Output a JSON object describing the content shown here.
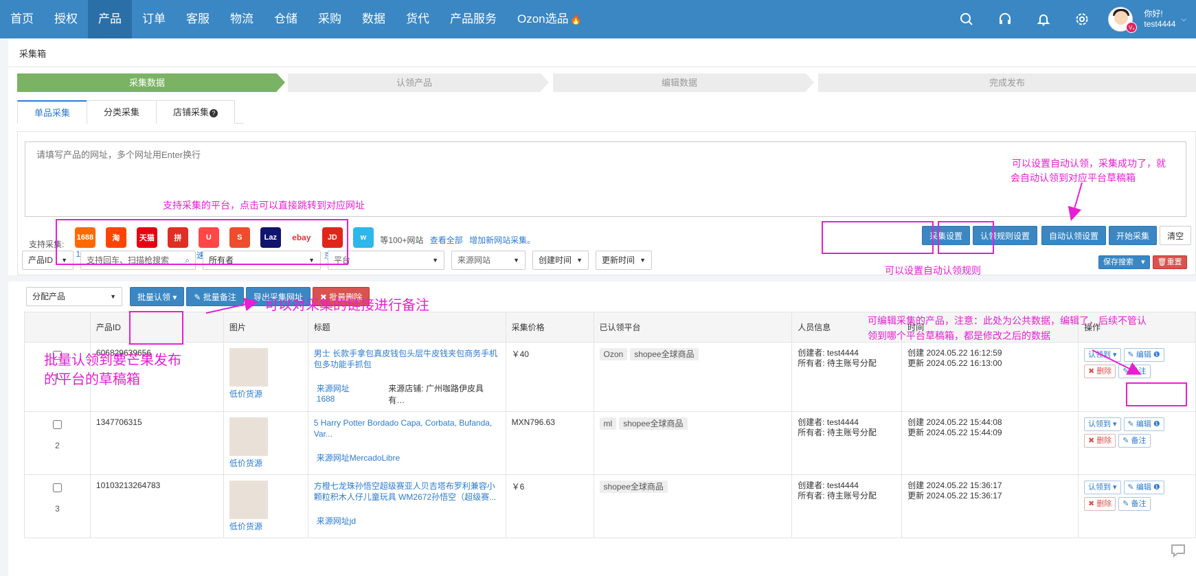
{
  "nav": {
    "items": [
      "首页",
      "授权",
      "产品",
      "订单",
      "客服",
      "物流",
      "仓储",
      "采购",
      "数据",
      "货代",
      "产品服务",
      "Ozon选品"
    ],
    "active_index": 2,
    "user_greeting": "你好!",
    "username": "test4444",
    "vip_badge": "V₄"
  },
  "breadcrumb": "采集箱",
  "steps": [
    "采集数据",
    "认领产品",
    "编辑数据",
    "完成发布"
  ],
  "tabs": [
    "单品采集",
    "分类采集",
    "店铺采集"
  ],
  "url_input": {
    "placeholder": "请填写产品的网址，多个网址用Enter换行"
  },
  "platforms": {
    "label": "支持采集:",
    "items": [
      {
        "name": "1688",
        "logo_text": "1688",
        "color": "#ff6a00"
      },
      {
        "name": "淘宝网",
        "logo_text": "淘",
        "color": "#ff4400"
      },
      {
        "name": "天猫",
        "logo_text": "天猫",
        "color": "#e60012"
      },
      {
        "name": "拼多多",
        "logo_text": "拼",
        "color": "#e02e24"
      },
      {
        "name": "速卖通",
        "logo_text": "U",
        "color": "#ff4747"
      },
      {
        "name": "shopee",
        "logo_text": "S",
        "color": "#ee4d2d"
      },
      {
        "name": "lazada",
        "logo_text": "Laz",
        "color": "#0f146d"
      },
      {
        "name": "ebay",
        "logo_text": "ebay",
        "color": "#ffffff"
      },
      {
        "name": "京东",
        "logo_text": "JD",
        "color": "#e1251b"
      },
      {
        "name": "wish",
        "logo_text": "w",
        "color": "#2fb7ec"
      }
    ],
    "more_text": "等100+网站",
    "view_all": "查看全部",
    "add_site": "增加新网站采集。"
  },
  "actions": {
    "collect_settings": "采集设置",
    "claim_rules": "认领规则设置",
    "auto_claim": "自动认领设置",
    "start": "开始采集",
    "clear": "清空"
  },
  "filters": {
    "product_id": "产品ID",
    "search_placeholder": "支持回车、扫描枪搜索",
    "owner": "所有者",
    "platform": "平台",
    "source_site": "来源网站",
    "created_time": "创建时间",
    "updated_time": "更新时间",
    "save_search": "保存搜索",
    "reset": "重置"
  },
  "toolbar": {
    "assign": "分配产品",
    "batch_claim": "批量认领",
    "batch_note": "批量备注",
    "export_urls": "导出采集网址",
    "batch_delete": "批量删除"
  },
  "table": {
    "headers": [
      "",
      "产品ID",
      "图片",
      "标题",
      "采集价格",
      "已认领平台",
      "人员信息",
      "时间",
      "操作"
    ],
    "rows": [
      {
        "index": "1",
        "id": "606829639656",
        "thumb_link": "低价货源",
        "title": "男士 长款手拿包真皮钱包头层牛皮钱夹包商务手机包多功能手抓包",
        "source": "来源网址1688",
        "store": "来源店铺: 广州咖路伊皮具有…",
        "price": "￥40",
        "platforms": [
          "Ozon",
          "shopee全球商品"
        ],
        "creator": "创建者:  test4444",
        "owner": "所有者:  待主账号分配",
        "created": "创建 2024.05.22 16:12:59",
        "updated": "更新 2024.05.22 16:13:00"
      },
      {
        "index": "2",
        "id": "1347706315",
        "thumb_link": "低价货源",
        "title": "5 Harry Potter Bordado Capa, Corbata, Bufanda, Var...",
        "source": "来源网址MercadoLibre",
        "store": "",
        "price": "MXN796.63",
        "platforms": [
          "ml",
          "shopee全球商品"
        ],
        "creator": "创建者:  test4444",
        "owner": "所有者:  待主账号分配",
        "created": "创建 2024.05.22 15:44:08",
        "updated": "更新 2024.05.22 15:44:09"
      },
      {
        "index": "3",
        "id": "10103213264783",
        "thumb_link": "低价货源",
        "title": "方橙七龙珠孙悟空超级赛亚人贝吉塔布罗利兼容小颗粒积木人仔儿童玩具 WM2672孙悟空（超级赛...",
        "source": "来源网址jd",
        "store": "",
        "price": "￥6",
        "platforms": [
          "shopee全球商品"
        ],
        "creator": "创建者:  test4444",
        "owner": "所有者:  待主账号分配",
        "created": "创建 2024.05.22 15:36:17",
        "updated": "更新 2024.05.22 15:36:17"
      }
    ],
    "op": {
      "claim": "认领到",
      "edit": "编辑",
      "delete": "删除",
      "note": "备注"
    }
  },
  "annotations": {
    "platforms_note": "支持采集的平台，点击可以直接跳转到对应网址",
    "auto_claim_note_1": "可以设置自动认领，采集成功了，就",
    "auto_claim_note_2": "会自动认领到对应平台草稿箱",
    "claim_rule_note": "可以设置自动认领规则",
    "batch_note_note": "可以对采集的链接进行备注",
    "batch_claim_note_1": "批量认领到要芒果发布",
    "batch_claim_note_2": "的平台的草稿箱",
    "edit_note_1": "可编辑采集的产品，注意：此处为公共数据，编辑了，后续不管认",
    "edit_note_2": "领到哪个平台草稿箱，都是修改之后的数据"
  },
  "colors": {
    "nav": "#3a87c4",
    "step_active": "#7ab364",
    "annotation": "#e61fd3",
    "primary": "#3a87c4"
  }
}
